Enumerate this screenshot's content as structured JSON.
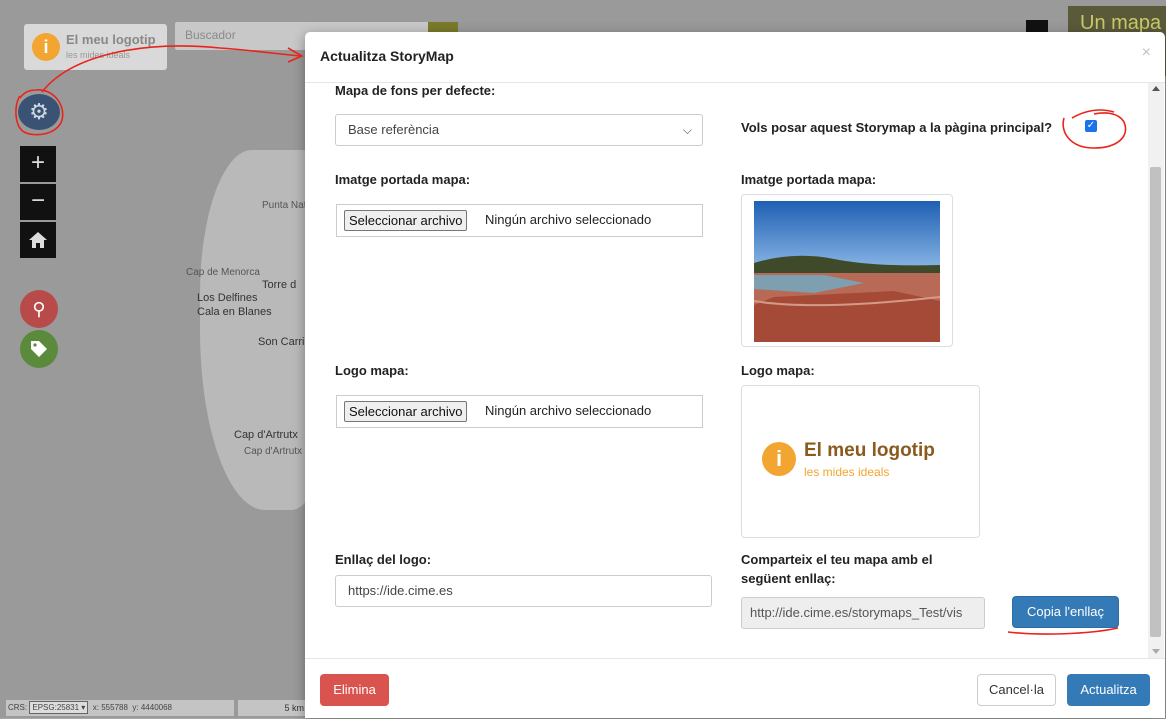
{
  "map": {
    "logo_title": "El meu logotip",
    "logo_subtitle": "les mides ideals",
    "search_placeholder": "Buscador",
    "right_title": "Un mapa",
    "places": [
      "Punta Nat",
      "Cap de Menorca",
      "Torre d",
      "Los Delfines",
      "Cala en Blanes",
      "Son Carri",
      "Cap d'Artrutx",
      "Cap d'Artrutx"
    ],
    "footer": {
      "crs_label": "CRS:",
      "crs_value": "EPSG:25831",
      "x_label": "x:",
      "x_value": "555788",
      "y_label": "y:",
      "y_value": "4440068",
      "scale": "5 km"
    },
    "tool_colors": {
      "gear": "#3a5273",
      "pin": "#b94a4a",
      "tag": "#5b8a3c"
    }
  },
  "modal": {
    "title": "Actualitza StoryMap",
    "close_symbol": "×",
    "basemap_label": "Mapa de fons per defecte:",
    "basemap_value": "Base referència",
    "main_page_question": "Vols posar aquest Storymap a la pàgina principal?",
    "main_page_checked": true,
    "cover_label_left": "Imatge portada mapa:",
    "cover_label_right": "Imatge portada mapa:",
    "file_button": "Seleccionar archivo",
    "file_none": "Ningún archivo seleccionado",
    "logo_label_left": "Logo mapa:",
    "logo_label_right": "Logo mapa:",
    "logo_preview_title": "El meu logotip",
    "logo_preview_subtitle": "les mides ideals",
    "link_label": "Enllaç del logo:",
    "link_value": "https://ide.cime.es",
    "share_label_line1": "Comparteix el teu mapa amb el",
    "share_label_line2": "següent enllaç:",
    "share_url": "http://ide.cime.es/storymaps_Test/vis",
    "copy_button": "Copia l'enllaç",
    "delete_button": "Elimina",
    "cancel_button": "Cancel·la",
    "update_button": "Actualitza"
  },
  "colors": {
    "primary": "#337ab7",
    "danger": "#d9534f",
    "annotation": "#e8241c",
    "logo_orange": "#f2a531",
    "logo_brown": "#8a5a1e"
  }
}
